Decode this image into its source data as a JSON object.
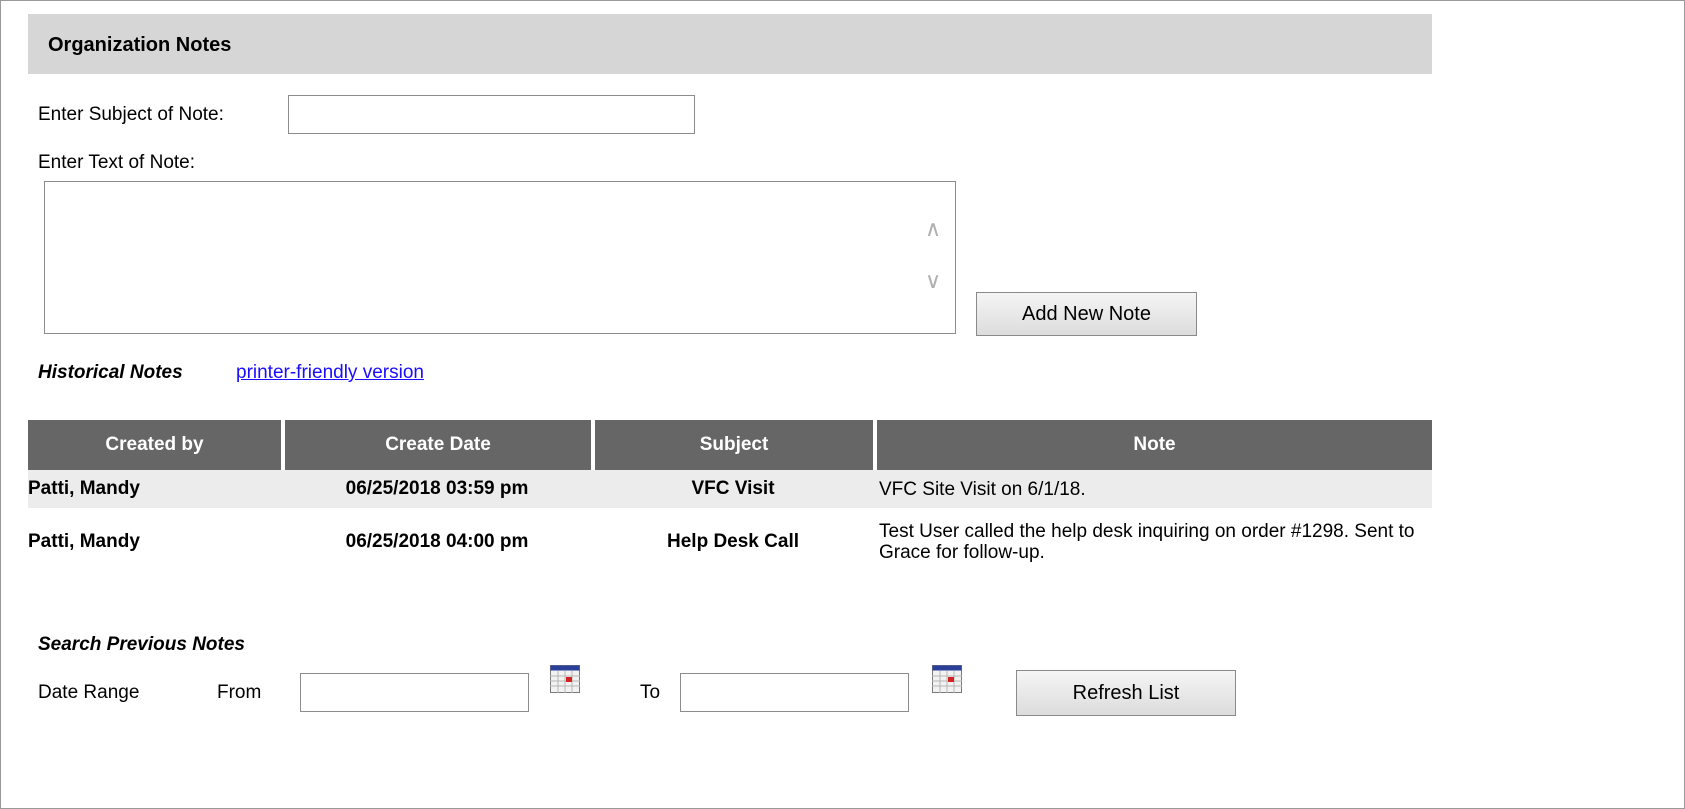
{
  "panel": {
    "title": "Organization Notes"
  },
  "form": {
    "subject_label": "Enter Subject of Note:",
    "subject_value": "",
    "text_label": "Enter Text of Note:",
    "text_value": "",
    "add_button": "Add New Note"
  },
  "historical": {
    "title": "Historical Notes",
    "link": "printer-friendly version"
  },
  "table": {
    "headers": [
      "Created by",
      "Create Date",
      "Subject",
      "Note"
    ],
    "rows": [
      {
        "created_by": "Patti, Mandy",
        "date": "06/25/2018 03:59 pm",
        "subject": "VFC Visit",
        "note": "VFC Site Visit on 6/1/18."
      },
      {
        "created_by": "Patti, Mandy",
        "date": "06/25/2018 04:00 pm",
        "subject": "Help Desk Call",
        "note": "Test User called the help desk inquiring on order #1298. Sent to Grace for follow-up."
      }
    ]
  },
  "search": {
    "title": "Search Previous Notes",
    "date_range_label": "Date Range",
    "from_label": "From",
    "from_value": "",
    "to_label": "To",
    "to_value": "",
    "refresh_button": "Refresh List"
  },
  "icons": {
    "calendar": "calendar-icon",
    "scroll_up": "chevron-up-icon",
    "scroll_down": "chevron-down-icon"
  },
  "colors": {
    "header_bg": "#d6d6d6",
    "table_header_bg": "#666666",
    "link": "#1a0dff",
    "row_alt": "#ececec"
  }
}
